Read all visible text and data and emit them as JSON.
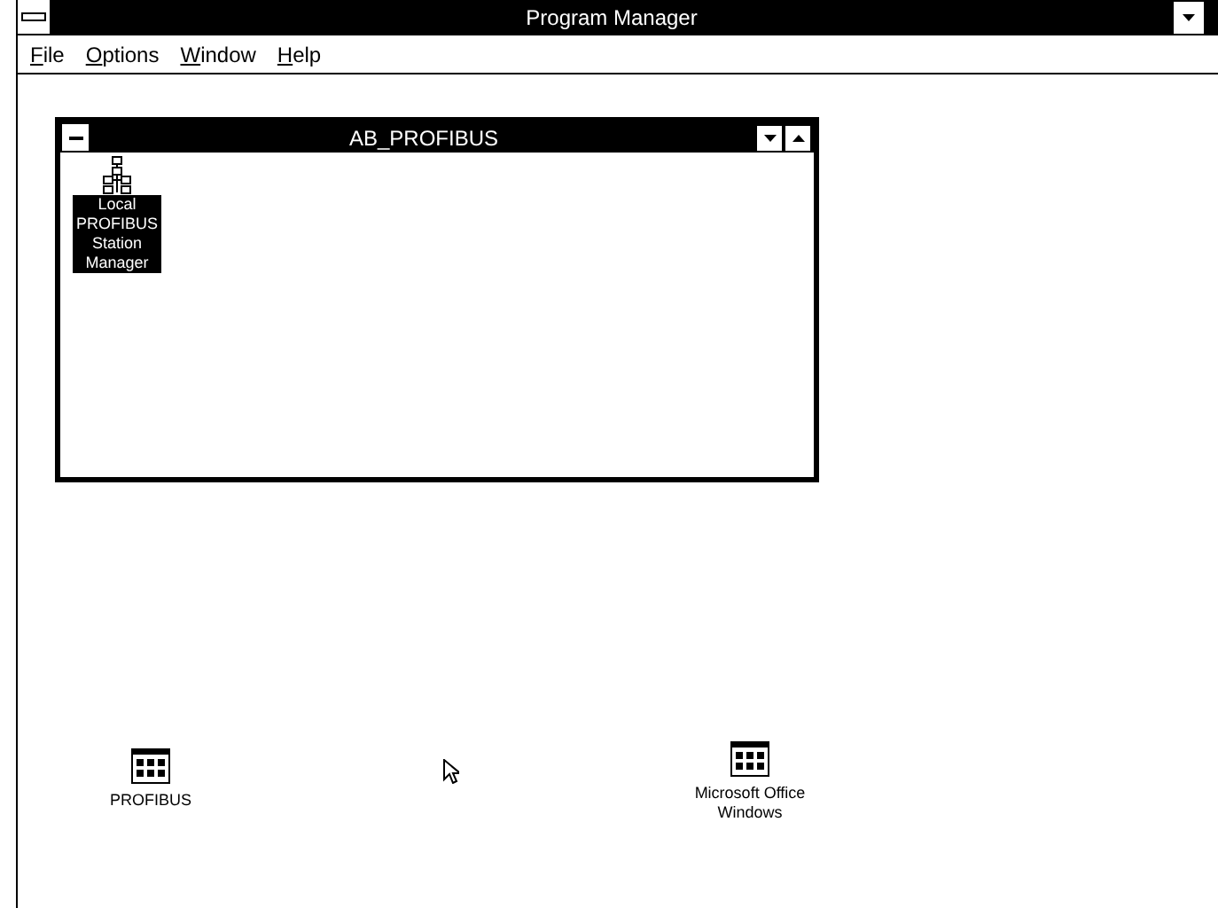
{
  "window": {
    "title": "Program Manager"
  },
  "menu": [
    {
      "label": "File"
    },
    {
      "label": "Options"
    },
    {
      "label": "Window"
    },
    {
      "label": "Help"
    }
  ],
  "group_window": {
    "title": "AB_PROFIBUS",
    "items": [
      {
        "label": "Local PROFIBUS Station Manager",
        "selected": true
      }
    ]
  },
  "minimized_groups": [
    {
      "label": "PROFIBUS"
    },
    {
      "label": "Microsoft Office Windows"
    }
  ]
}
